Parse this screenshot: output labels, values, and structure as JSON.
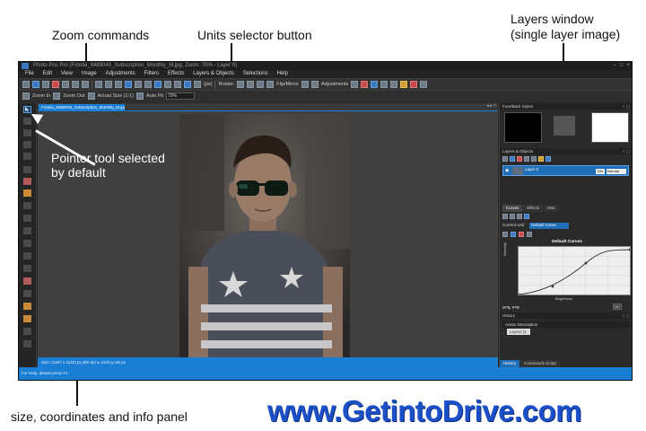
{
  "annotations": {
    "zoom_commands": "Zoom commands",
    "units_selector": "Units selector button",
    "layers_window_line1": "Layers window",
    "layers_window_line2": "(single layer image)",
    "pointer_tool_line1": "Pointer tool selected",
    "pointer_tool_line2": "by default",
    "info_panel": "size, coordinates and info panel"
  },
  "window": {
    "title": "Photo Pos Pro (Fotolia_8489045_Subscription_Monthly_M.jpg, Zoom: 70% - Layer 0)",
    "controls": [
      "–",
      "□",
      "×"
    ]
  },
  "menu": [
    "File",
    "Edit",
    "View",
    "Image",
    "Adjustments",
    "Filters",
    "Effects",
    "Layers & Objects",
    "Selections",
    "Help"
  ],
  "toolbar": {
    "units_label": "(px)",
    "rotate_label": "Rotate:",
    "flip_label": "Flip/Mirror",
    "adjustments_label": "Adjustments"
  },
  "zoombar": {
    "zoom_in": "Zoom In",
    "zoom_out": "Zoom Out",
    "actual_size": "Actual Size (1:1)",
    "auto_fit": "Auto Fit",
    "zoom_value": "70%"
  },
  "document": {
    "tab_label": "Fotolia_8489045_Subscription_Monthly_M.jpg",
    "status": "Size: (1467 x 1120) px,300 dpi    x=1210,y=50 px"
  },
  "panels": {
    "fore_back_title": "Fore/Back Styles",
    "layers_title": "Layers & Objects",
    "layer_name": "Layer 0",
    "layer_opacity": "100",
    "layer_mode": "Normal",
    "curves_tabs": [
      "Curves",
      "Effects",
      "Misc"
    ],
    "curves_unit": "Current Unit",
    "curves_preset": "Default Curve",
    "curves_title": "Default Curves",
    "curves_xlabel": "Brightness",
    "curves_ylabel": "Intensity",
    "curves_readout": "X=0,  Y=0",
    "curves_ticks_x": [
      "0",
      "20",
      "40",
      "60",
      "80",
      "100"
    ],
    "curves_ticks_y": [
      "100",
      "80",
      "60",
      "40",
      "20"
    ],
    "curves_ok": "OK",
    "history_title": "History",
    "history_item": "Action Description",
    "history_row": "Layers (1 of 1)",
    "bottom_tabs": [
      "History",
      "Commands Script"
    ]
  },
  "app_status": "For Help, please press F1",
  "watermark": "www.GetintoDrive.com"
}
